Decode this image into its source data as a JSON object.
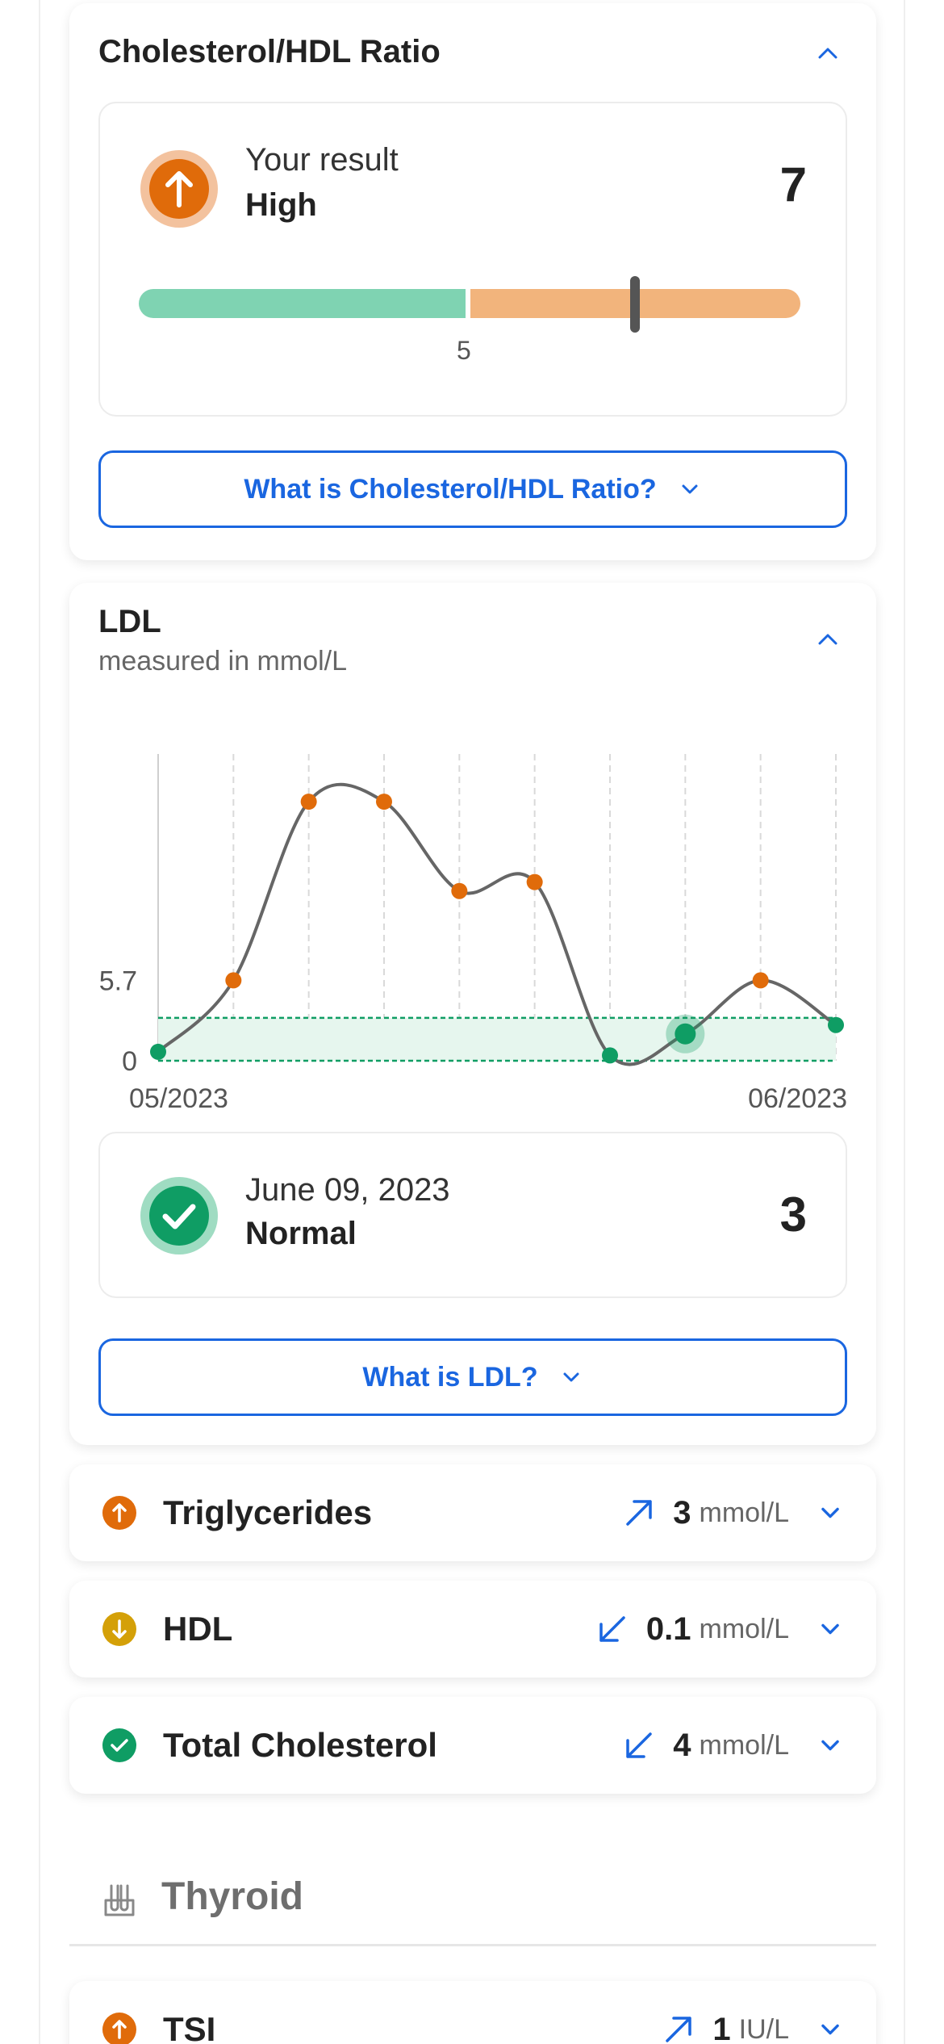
{
  "ratio_card": {
    "title": "Cholesterol/HDL Ratio",
    "result_label": "Your result",
    "result_status": "High",
    "result_value": "7",
    "range_marker_label": "5",
    "range_indicator_fraction": 0.75,
    "explain_button": "What is Cholesterol/HDL Ratio?"
  },
  "ldl_card": {
    "title": "LDL",
    "subtitle": "measured in mmol/L",
    "result_date": "June 09, 2023",
    "result_status": "Normal",
    "result_value": "3",
    "explain_button": "What is LDL?"
  },
  "chart_data": {
    "type": "line",
    "x": [
      "05/2023",
      "",
      "",
      "",
      "",
      "",
      "",
      "",
      "",
      "06/2023"
    ],
    "series": [
      {
        "values": [
          0.5,
          4.5,
          14.5,
          14.5,
          9.5,
          10,
          0.3,
          1.5,
          4.5,
          2
        ]
      }
    ],
    "y_tick_labels": [
      "0",
      "5.7"
    ],
    "x_tick_labels": [
      "05/2023",
      "06/2023"
    ],
    "normal_range": [
      0,
      2.4
    ],
    "selected_point_index": 7,
    "point_status": [
      "normal",
      "high",
      "high",
      "high",
      "high",
      "high",
      "normal",
      "normal",
      "high",
      "normal"
    ],
    "colors": {
      "normal": "#0f9d64",
      "high": "#e06b0a",
      "line": "#666666",
      "band": "#e6f6ee"
    }
  },
  "rows": [
    {
      "name": "Triglycerides",
      "status": "high",
      "trend": "up",
      "value": "3",
      "unit": "mmol/L"
    },
    {
      "name": "HDL",
      "status": "low",
      "trend": "down",
      "value": "0.1",
      "unit": "mmol/L"
    },
    {
      "name": "Total Cholesterol",
      "status": "normal",
      "trend": "down",
      "value": "4",
      "unit": "mmol/L"
    }
  ],
  "section": {
    "title": "Thyroid",
    "icon": "test-tubes-icon"
  },
  "tsi_row": {
    "name": "TSI",
    "status": "high",
    "trend": "up",
    "value": "1",
    "unit": "IU/L"
  },
  "colors": {
    "accent": "#1a66e0",
    "high": "#e06b0a",
    "low": "#d4a008",
    "normal": "#0f9d64",
    "range_normal": "#7fd3b2",
    "range_high": "#f2b47c"
  }
}
